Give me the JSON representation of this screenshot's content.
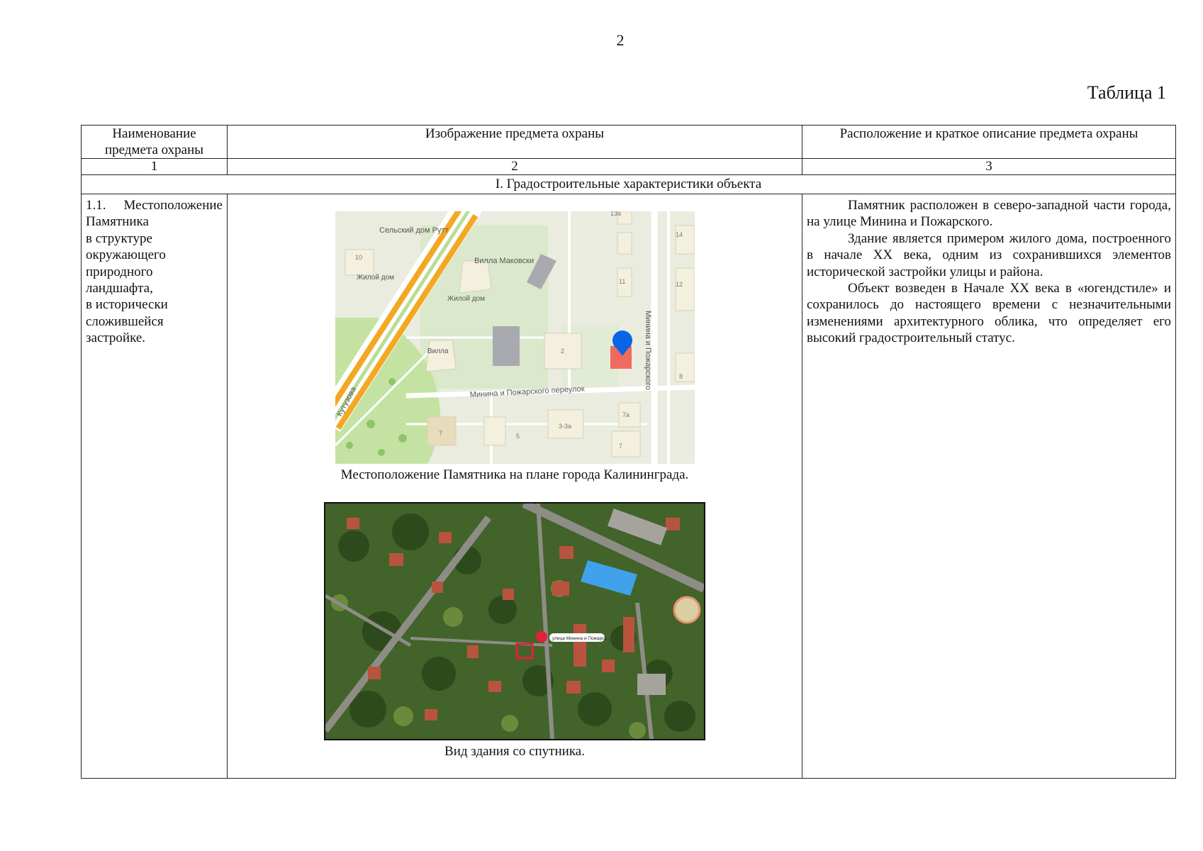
{
  "page": {
    "number": "2",
    "table_title": "Таблица 1"
  },
  "table": {
    "headers": [
      "Наименование предмета охраны",
      "Изображение предмета охраны",
      "Расположение и краткое описание предмета охраны"
    ],
    "column_numbers": [
      "1",
      "2",
      "3"
    ],
    "section_title": "I. Градостроительные характеристики объекта",
    "row": {
      "name_first": [
        "1.1.",
        "Местоположение"
      ],
      "name_lines": [
        "Памятника",
        "в структуре",
        "окружающего",
        "природного",
        "ландшафта,",
        "в исторически",
        "сложившейся",
        "застройке."
      ],
      "map_caption": "Местоположение Памятника на плане города Калининграда.",
      "satellite_caption": "Вид здания  со спутника.",
      "description": [
        "Памятник расположен в северо-западной части города, на улице Минина и Пожарского.",
        "Здание является примером жилого дома, построенного в начале XX века, одним из сохранившихся элементов исторической застройки улицы и района.",
        "Объект возведен в Начале XX века в «югендстиле» и сохранилось до настоящего времени с незначительными изменениями архитектурного облика, что определяет его высокий градостроительный статус."
      ]
    }
  },
  "map": {
    "labels": {
      "rutt": "Сельский дом Рутт",
      "makovski": "Вилла Маковски",
      "house1": "Жилой дом",
      "house2": "Жилой дом",
      "villa": "Вилла",
      "lane": "Минина и Пожарского переулок",
      "street": "Минина и Пожарского",
      "kutuzova": "Кутузова"
    },
    "house_numbers": {
      "n13a": "13а",
      "n14": "14",
      "n10": "10",
      "n11": "11",
      "n12": "12",
      "n2": "2",
      "n8": "8",
      "n7a": "7а",
      "n7": "7",
      "n5": "5",
      "n33a": "3-3а",
      "n7b": "7"
    },
    "colors": {
      "background": "#e9ecdf",
      "park": "#c4e3a2",
      "avenue": "#f3a823",
      "road": "#ffffff",
      "marker": "#0a64e6",
      "building_highlight": "#ef6b5e"
    }
  },
  "satellite": {
    "marker_label": "улица Минина и Пожарск...",
    "colors": {
      "vegetation": "#3b5a26",
      "roof": "#b8543e",
      "road": "#8d8d86",
      "highlight_building": "#3fa2ea",
      "marker": "#e41f3a"
    }
  }
}
